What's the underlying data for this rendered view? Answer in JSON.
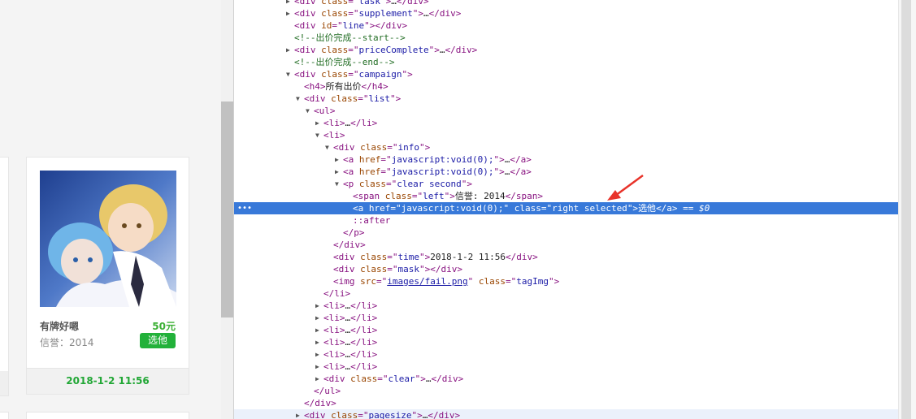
{
  "card": {
    "name": "有牌好嗯",
    "price": "50元",
    "credit": "信誉：2014",
    "pick_label": "选他",
    "time": "2018-1-2 11:56"
  },
  "colors": {
    "accent_green": "#22b13a",
    "selection_blue": "#3879d9",
    "arrow_red": "#e8332a"
  },
  "devtools": {
    "selected_suffix": "== $0",
    "lines": [
      {
        "indent": 0,
        "tri": "▶",
        "parts": [
          [
            "t",
            "<div "
          ],
          [
            "a",
            "class"
          ],
          [
            "t",
            "=\""
          ],
          [
            "v",
            "task"
          ],
          [
            "t",
            "\">"
          ],
          [
            "p",
            "…"
          ],
          [
            "t",
            "</div>"
          ]
        ]
      },
      {
        "indent": 0,
        "tri": "▶",
        "parts": [
          [
            "t",
            "<div "
          ],
          [
            "a",
            "class"
          ],
          [
            "t",
            "=\""
          ],
          [
            "v",
            "supplement"
          ],
          [
            "t",
            "\">"
          ],
          [
            "p",
            "…"
          ],
          [
            "t",
            "</div>"
          ]
        ]
      },
      {
        "indent": 0,
        "tri": "",
        "parts": [
          [
            "t",
            "<div "
          ],
          [
            "a",
            "id"
          ],
          [
            "t",
            "=\""
          ],
          [
            "v",
            "line"
          ],
          [
            "t",
            "\"></div>"
          ]
        ]
      },
      {
        "indent": 0,
        "tri": "",
        "parts": [
          [
            "c",
            "<!--出价完成--start-->"
          ]
        ]
      },
      {
        "indent": 0,
        "tri": "▶",
        "parts": [
          [
            "t",
            "<div "
          ],
          [
            "a",
            "class"
          ],
          [
            "t",
            "=\""
          ],
          [
            "v",
            "priceComplete"
          ],
          [
            "t",
            "\">"
          ],
          [
            "p",
            "…"
          ],
          [
            "t",
            "</div>"
          ]
        ]
      },
      {
        "indent": 0,
        "tri": "",
        "parts": [
          [
            "c",
            "<!--出价完成--end-->"
          ]
        ]
      },
      {
        "indent": 0,
        "tri": "▼",
        "parts": [
          [
            "t",
            "<div "
          ],
          [
            "a",
            "class"
          ],
          [
            "t",
            "=\""
          ],
          [
            "v",
            "campaign"
          ],
          [
            "t",
            "\">"
          ]
        ]
      },
      {
        "indent": 1,
        "tri": "",
        "parts": [
          [
            "t",
            "<h4>"
          ],
          [
            "p",
            "所有出价"
          ],
          [
            "t",
            "</h4>"
          ]
        ]
      },
      {
        "indent": 1,
        "tri": "▼",
        "parts": [
          [
            "t",
            "<div "
          ],
          [
            "a",
            "class"
          ],
          [
            "t",
            "=\""
          ],
          [
            "v",
            "list"
          ],
          [
            "t",
            "\">"
          ]
        ]
      },
      {
        "indent": 2,
        "tri": "▼",
        "parts": [
          [
            "t",
            "<ul>"
          ]
        ]
      },
      {
        "indent": 3,
        "tri": "▶",
        "parts": [
          [
            "t",
            "<li>"
          ],
          [
            "p",
            "…"
          ],
          [
            "t",
            "</li>"
          ]
        ]
      },
      {
        "indent": 3,
        "tri": "▼",
        "parts": [
          [
            "t",
            "<li>"
          ]
        ]
      },
      {
        "indent": 4,
        "tri": "▼",
        "parts": [
          [
            "t",
            "<div "
          ],
          [
            "a",
            "class"
          ],
          [
            "t",
            "=\""
          ],
          [
            "v",
            "info"
          ],
          [
            "t",
            "\">"
          ]
        ]
      },
      {
        "indent": 5,
        "tri": "▶",
        "parts": [
          [
            "t",
            "<a "
          ],
          [
            "a",
            "href"
          ],
          [
            "t",
            "=\""
          ],
          [
            "v",
            "javascript:void(0);"
          ],
          [
            "t",
            "\">"
          ],
          [
            "p",
            "…"
          ],
          [
            "t",
            "</a>"
          ]
        ]
      },
      {
        "indent": 5,
        "tri": "▶",
        "parts": [
          [
            "t",
            "<a "
          ],
          [
            "a",
            "href"
          ],
          [
            "t",
            "=\""
          ],
          [
            "v",
            "javascript:void(0);"
          ],
          [
            "t",
            "\">"
          ],
          [
            "p",
            "…"
          ],
          [
            "t",
            "</a>"
          ]
        ]
      },
      {
        "indent": 5,
        "tri": "▼",
        "parts": [
          [
            "t",
            "<p "
          ],
          [
            "a",
            "class"
          ],
          [
            "t",
            "=\""
          ],
          [
            "v",
            "clear second"
          ],
          [
            "t",
            "\">"
          ]
        ]
      },
      {
        "indent": 6,
        "tri": "",
        "parts": [
          [
            "t",
            "<span "
          ],
          [
            "a",
            "class"
          ],
          [
            "t",
            "=\""
          ],
          [
            "v",
            "left"
          ],
          [
            "t",
            "\">"
          ],
          [
            "p",
            "信誉: 2014"
          ],
          [
            "t",
            "</span>"
          ]
        ]
      },
      {
        "indent": 6,
        "tri": "",
        "sel": true,
        "parts": [
          [
            "t",
            "<a "
          ],
          [
            "a",
            "href"
          ],
          [
            "t",
            "=\""
          ],
          [
            "v",
            "javascript:void(0);"
          ],
          [
            "t",
            "\" "
          ],
          [
            "a",
            "class"
          ],
          [
            "t",
            "=\""
          ],
          [
            "v",
            "right selected"
          ],
          [
            "t",
            "\">"
          ],
          [
            "p",
            "选他"
          ],
          [
            "t",
            "</a>"
          ]
        ]
      },
      {
        "indent": 6,
        "tri": "",
        "parts": [
          [
            "t",
            "::after"
          ]
        ]
      },
      {
        "indent": 5,
        "tri": "",
        "parts": [
          [
            "t",
            "</p>"
          ]
        ]
      },
      {
        "indent": 4,
        "tri": "",
        "parts": [
          [
            "t",
            "</div>"
          ]
        ]
      },
      {
        "indent": 4,
        "tri": "",
        "parts": [
          [
            "t",
            "<div "
          ],
          [
            "a",
            "class"
          ],
          [
            "t",
            "=\""
          ],
          [
            "v",
            "time"
          ],
          [
            "t",
            "\">"
          ],
          [
            "p",
            "2018-1-2 11:56"
          ],
          [
            "t",
            "</div>"
          ]
        ]
      },
      {
        "indent": 4,
        "tri": "",
        "parts": [
          [
            "t",
            "<div "
          ],
          [
            "a",
            "class"
          ],
          [
            "t",
            "=\""
          ],
          [
            "v",
            "mask"
          ],
          [
            "t",
            "\"></div>"
          ]
        ]
      },
      {
        "indent": 4,
        "tri": "",
        "parts": [
          [
            "t",
            "<img "
          ],
          [
            "a",
            "src"
          ],
          [
            "t",
            "=\""
          ],
          [
            "u",
            "images/fail.png"
          ],
          [
            "t",
            "\" "
          ],
          [
            "a",
            "class"
          ],
          [
            "t",
            "=\""
          ],
          [
            "v",
            "tagImg"
          ],
          [
            "t",
            "\">"
          ]
        ]
      },
      {
        "indent": 3,
        "tri": "",
        "parts": [
          [
            "t",
            "</li>"
          ]
        ]
      },
      {
        "indent": 3,
        "tri": "▶",
        "parts": [
          [
            "t",
            "<li>"
          ],
          [
            "p",
            "…"
          ],
          [
            "t",
            "</li>"
          ]
        ]
      },
      {
        "indent": 3,
        "tri": "▶",
        "parts": [
          [
            "t",
            "<li>"
          ],
          [
            "p",
            "…"
          ],
          [
            "t",
            "</li>"
          ]
        ]
      },
      {
        "indent": 3,
        "tri": "▶",
        "parts": [
          [
            "t",
            "<li>"
          ],
          [
            "p",
            "…"
          ],
          [
            "t",
            "</li>"
          ]
        ]
      },
      {
        "indent": 3,
        "tri": "▶",
        "parts": [
          [
            "t",
            "<li>"
          ],
          [
            "p",
            "…"
          ],
          [
            "t",
            "</li>"
          ]
        ]
      },
      {
        "indent": 3,
        "tri": "▶",
        "parts": [
          [
            "t",
            "<li>"
          ],
          [
            "p",
            "…"
          ],
          [
            "t",
            "</li>"
          ]
        ]
      },
      {
        "indent": 3,
        "tri": "▶",
        "parts": [
          [
            "t",
            "<li>"
          ],
          [
            "p",
            "…"
          ],
          [
            "t",
            "</li>"
          ]
        ]
      },
      {
        "indent": 3,
        "tri": "▶",
        "parts": [
          [
            "t",
            "<div "
          ],
          [
            "a",
            "class"
          ],
          [
            "t",
            "=\""
          ],
          [
            "v",
            "clear"
          ],
          [
            "t",
            "\">"
          ],
          [
            "p",
            "…"
          ],
          [
            "t",
            "</div>"
          ]
        ]
      },
      {
        "indent": 2,
        "tri": "",
        "parts": [
          [
            "t",
            "</ul>"
          ]
        ]
      },
      {
        "indent": 1,
        "tri": "",
        "parts": [
          [
            "t",
            "</div>"
          ]
        ]
      },
      {
        "indent": 1,
        "tri": "▶",
        "hover": true,
        "parts": [
          [
            "t",
            "<div "
          ],
          [
            "a",
            "class"
          ],
          [
            "t",
            "=\""
          ],
          [
            "v",
            "pagesize"
          ],
          [
            "t",
            "\">"
          ],
          [
            "p",
            "…"
          ],
          [
            "t",
            "</div>"
          ]
        ]
      }
    ]
  }
}
